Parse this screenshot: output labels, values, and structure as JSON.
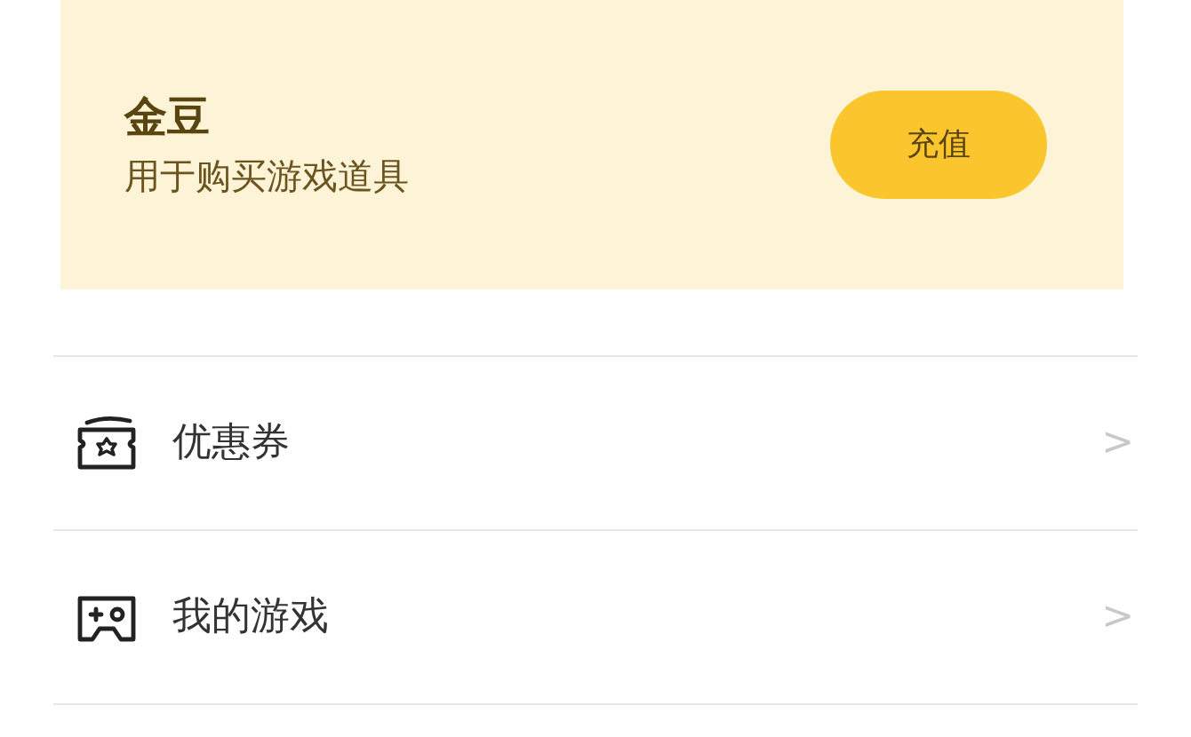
{
  "banner": {
    "title": "金豆",
    "subtitle": "用于购买游戏道具",
    "button": "充值"
  },
  "menu": [
    {
      "label": "优惠券",
      "chevron": ">"
    },
    {
      "label": "我的游戏",
      "chevron": ">"
    }
  ]
}
